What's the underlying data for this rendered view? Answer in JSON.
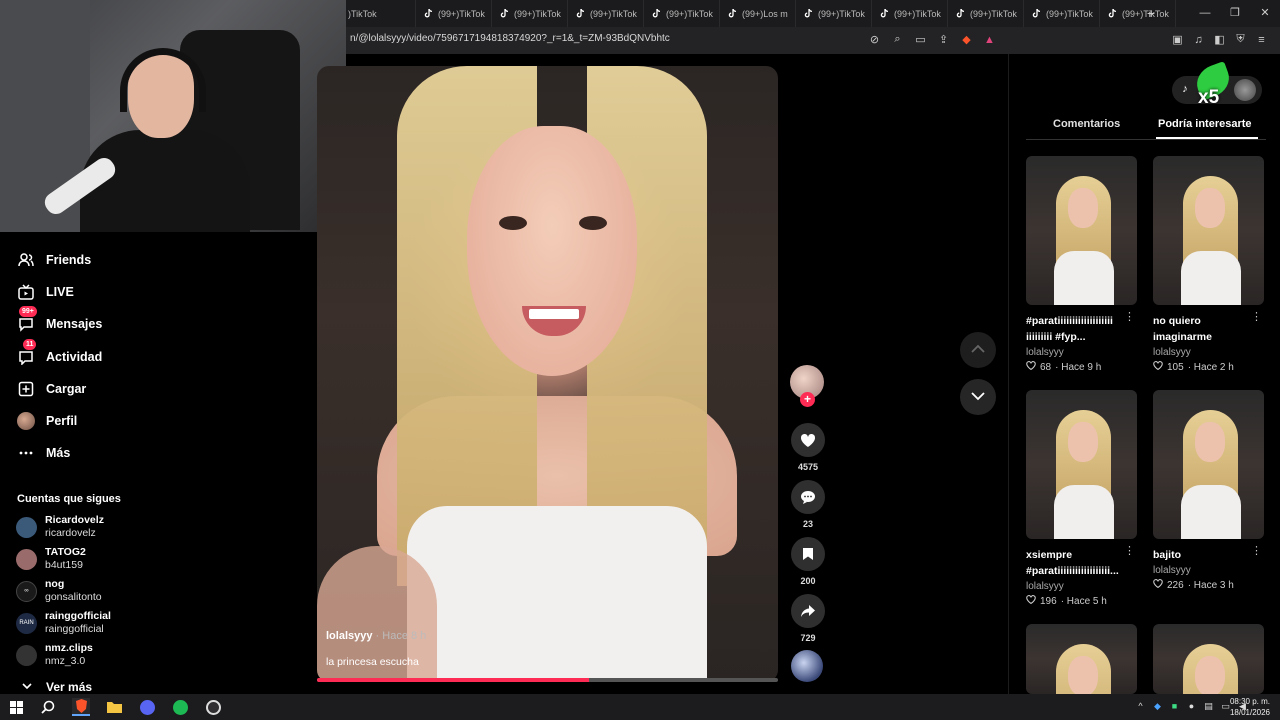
{
  "browser": {
    "tabs": [
      {
        "label": ")TikTok"
      },
      {
        "label": "(99+)TikTok"
      },
      {
        "label": "(99+)TikTok"
      },
      {
        "label": "(99+)TikTok"
      },
      {
        "label": "(99+)TikTok"
      },
      {
        "label": "(99+)Los m"
      },
      {
        "label": "(99+)TikTok"
      },
      {
        "label": "(99+)TikTok"
      },
      {
        "label": "(99+)TikTok"
      },
      {
        "label": "(99+)TikTok"
      },
      {
        "label": "(99+)TikTok"
      }
    ],
    "new_tab_icon": "plus-icon",
    "url": "n/@lolalsyyy/video/7596717194818374920?_r=1&_t=ZM-93BdQNVbhtc"
  },
  "nav": {
    "items": [
      {
        "label": "Friends",
        "icon": "friends-icon"
      },
      {
        "label": "LIVE",
        "icon": "live-icon"
      },
      {
        "label": "Mensajes",
        "icon": "messages-icon",
        "badge": "99+"
      },
      {
        "label": "Actividad",
        "icon": "activity-icon",
        "badge": "11"
      },
      {
        "label": "Cargar",
        "icon": "upload-icon"
      },
      {
        "label": "Perfil",
        "icon": "profile-icon"
      },
      {
        "label": "Más",
        "icon": "more-icon"
      }
    ],
    "following_title": "Cuentas que sigues",
    "following": [
      {
        "name": "Ricardovelz",
        "handle": "ricardovelz",
        "color": "#3b5a7a"
      },
      {
        "name": "TATOG2",
        "handle": "b4ut159",
        "color": "#9a6b6b"
      },
      {
        "name": "nog",
        "handle": "gonsalitonto",
        "color": "#1a1a1a"
      },
      {
        "name": "rainggofficial",
        "handle": "rainggofficial",
        "color": "#1e2a44"
      },
      {
        "name": "nmz.clips",
        "handle": "nmz_3.0",
        "color": "#333333"
      }
    ],
    "ver_mas": "Ver más"
  },
  "video": {
    "username": "lolalsyyy",
    "time": " · Hace 8 h",
    "description": "la princesa escucha",
    "progress": 0.59
  },
  "actions": {
    "like_count": "4575",
    "comment_count": "23",
    "save_count": "200",
    "share_count": "729"
  },
  "panel": {
    "badge_text": "x5",
    "tab_comments": "Comentarios",
    "tab_interest": "Podría interesarte",
    "cards": [
      {
        "title": "#paratiiiiiiiiiiiiiiiiiii iiiiiiiii #fyp...",
        "author": "lolalsyyy",
        "likes": "68",
        "time": "· Hace 9 h"
      },
      {
        "title": "no quiero imaginarme",
        "author": "lolalsyyy",
        "likes": "105",
        "time": "· Hace 2 h"
      },
      {
        "title": "xsiempre #paratiiiiiiiiiiiiiiiiii...",
        "author": "lolalsyyy",
        "likes": "196",
        "time": "· Hace 5 h"
      },
      {
        "title": "bajito",
        "author": "lolalsyyy",
        "likes": "226",
        "time": "· Hace 3 h"
      }
    ]
  },
  "taskbar": {
    "time": "08:30 p. m.",
    "date": "18/01/2026"
  },
  "colors": {
    "accent": "#fe2c55",
    "background": "#000000"
  }
}
